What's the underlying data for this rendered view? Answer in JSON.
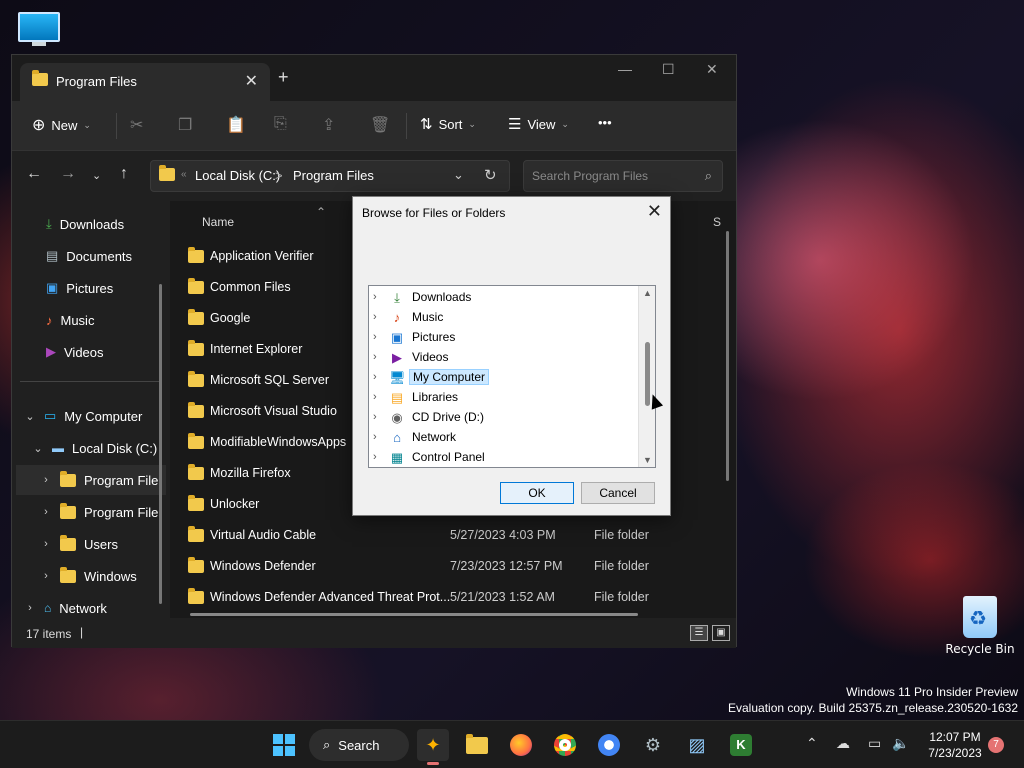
{
  "desktop": {
    "recycle_bin_label": "Recycle Bin",
    "watermark_line1": "Windows 11 Pro Insider Preview",
    "watermark_line2": "Evaluation copy. Build 25375.zn_release.230520-1632"
  },
  "explorer": {
    "tab_title": "Program Files",
    "toolbar": {
      "new_label": "New",
      "sort_label": "Sort",
      "view_label": "View",
      "more_label": "•••"
    },
    "address": {
      "crumb1": "Local Disk (C:)",
      "separator": ">",
      "crumb2": "Program Files"
    },
    "search_placeholder": "Search Program Files",
    "sidebar": {
      "quick": [
        {
          "label": "Downloads",
          "icon": "download-icon"
        },
        {
          "label": "Documents",
          "icon": "document-icon"
        },
        {
          "label": "Pictures",
          "icon": "pictures-icon"
        },
        {
          "label": "Music",
          "icon": "music-icon"
        },
        {
          "label": "Videos",
          "icon": "videos-icon"
        }
      ],
      "tree": [
        {
          "label": "My Computer"
        },
        {
          "label": "Local Disk (C:)"
        },
        {
          "label": "Program File"
        },
        {
          "label": "Program File"
        },
        {
          "label": "Users"
        },
        {
          "label": "Windows"
        },
        {
          "label": "Network"
        }
      ]
    },
    "columns": {
      "name": "Name",
      "s": "S"
    },
    "files": [
      {
        "name": "Application Verifier",
        "date": "",
        "type": ""
      },
      {
        "name": "Common Files",
        "date": "",
        "type": ""
      },
      {
        "name": "Google",
        "date": "",
        "type": ""
      },
      {
        "name": "Internet Explorer",
        "date": "",
        "type": ""
      },
      {
        "name": "Microsoft SQL Server",
        "date": "",
        "type": ""
      },
      {
        "name": "Microsoft Visual Studio",
        "date": "",
        "type": ""
      },
      {
        "name": "ModifiableWindowsApps",
        "date": "",
        "type": ""
      },
      {
        "name": "Mozilla Firefox",
        "date": "",
        "type": ""
      },
      {
        "name": "Unlocker",
        "date": "",
        "type": ""
      },
      {
        "name": "Virtual Audio Cable",
        "date": "5/27/2023 4:03 PM",
        "type": "File folder"
      },
      {
        "name": "Windows Defender",
        "date": "7/23/2023 12:57 PM",
        "type": "File folder"
      },
      {
        "name": "Windows Defender Advanced Threat Prot...",
        "date": "5/21/2023 1:52 AM",
        "type": "File folder"
      }
    ],
    "status": {
      "count": "17 items"
    }
  },
  "dialog": {
    "title": "Browse for Files or Folders",
    "items": [
      {
        "label": "Downloads",
        "icon": "download-icon",
        "glyph": "⤓",
        "color": "#2e7d32"
      },
      {
        "label": "Music",
        "icon": "music-icon",
        "glyph": "♪",
        "color": "#d84315"
      },
      {
        "label": "Pictures",
        "icon": "pictures-icon",
        "glyph": "▣",
        "color": "#1976d2"
      },
      {
        "label": "Videos",
        "icon": "videos-icon",
        "glyph": "▶",
        "color": "#7b1fa2"
      },
      {
        "label": "My Computer",
        "icon": "computer-icon",
        "glyph": "🖥",
        "color": "#0288d1"
      },
      {
        "label": "Libraries",
        "icon": "libraries-icon",
        "glyph": "▤",
        "color": "#f9a825"
      },
      {
        "label": "CD Drive (D:)",
        "icon": "cd-drive-icon",
        "glyph": "◉",
        "color": "#616161"
      },
      {
        "label": "Network",
        "icon": "network-icon",
        "glyph": "⌂",
        "color": "#1565c0"
      },
      {
        "label": "Control Panel",
        "icon": "control-panel-icon",
        "glyph": "▦",
        "color": "#00838f"
      }
    ],
    "selected_index": 4,
    "ok_label": "OK",
    "cancel_label": "Cancel"
  },
  "taskbar": {
    "search_label": "Search",
    "time": "12:07 PM",
    "date": "7/23/2023",
    "notification_count": "7"
  }
}
